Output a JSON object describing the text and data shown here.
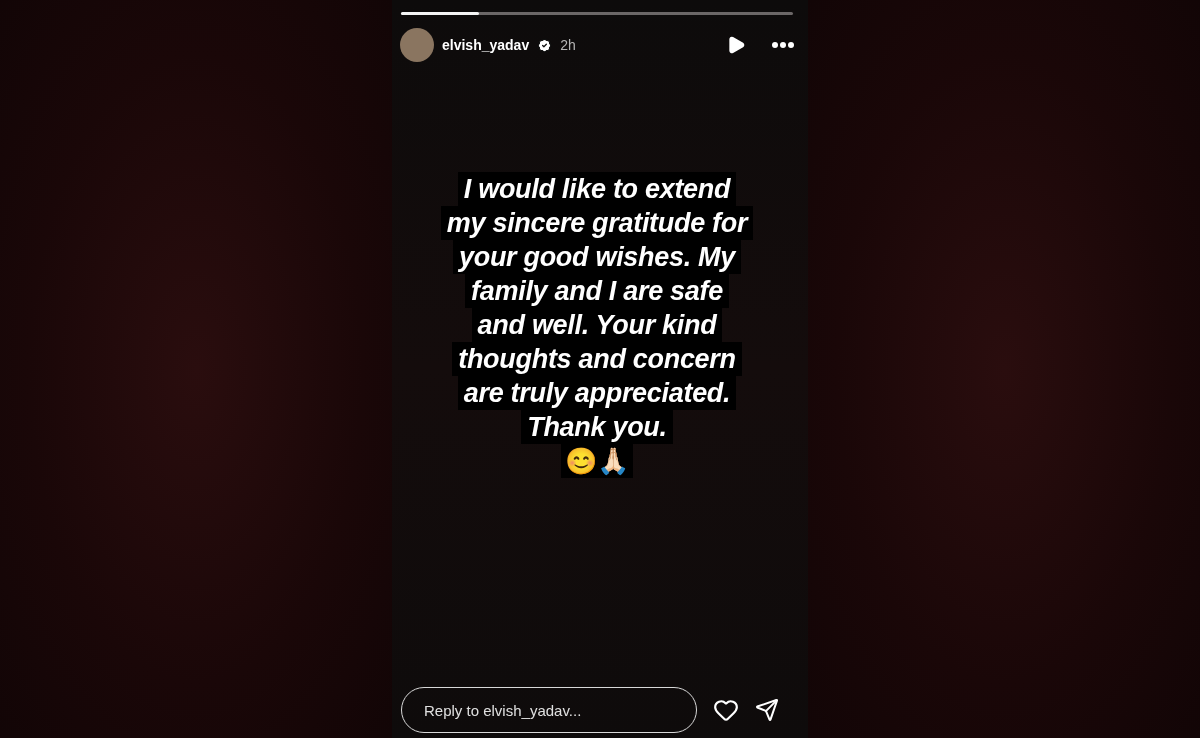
{
  "story": {
    "progress": {
      "level": 0.2
    },
    "username": "elvish_yadav",
    "verified": true,
    "time": "2h",
    "text_lines": [
      "I would like to extend",
      "my sincere gratitude for",
      "your good wishes. My",
      "family and I are safe",
      "and well. Your kind",
      "thoughts and concern",
      "are truly appreciated.",
      "Thank you."
    ],
    "emoji": "😊🙏🏻",
    "reply": {
      "placeholder": "Reply to elvish_yadav..."
    }
  }
}
